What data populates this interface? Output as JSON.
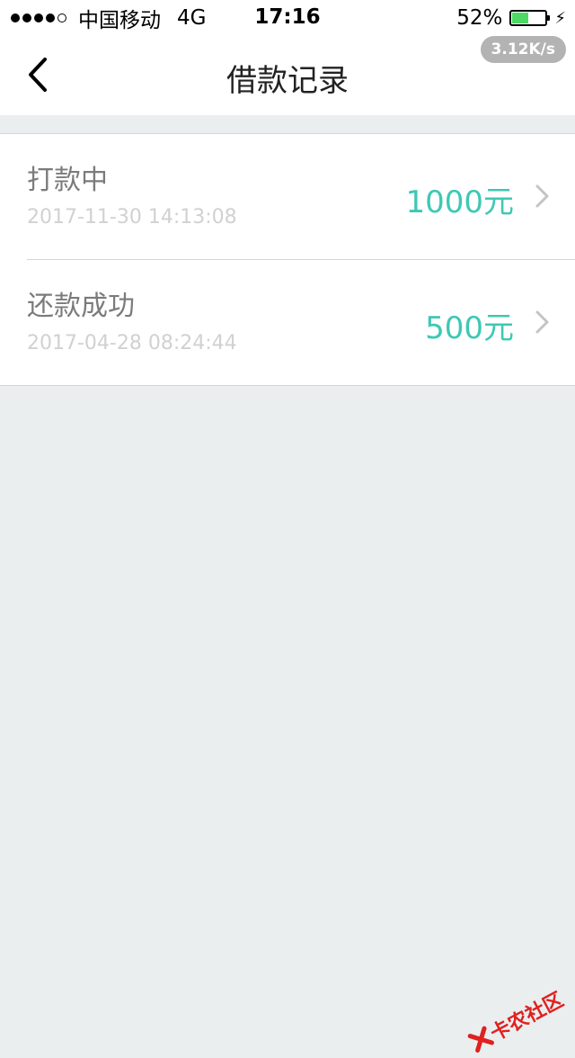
{
  "status_bar": {
    "carrier": "中国移动",
    "network": "4G",
    "time": "17:16",
    "battery_percent": "52%",
    "battery_level": 0.52,
    "signal_dots_filled": 4,
    "signal_dots_total": 5
  },
  "net_speed": "3.12K/s",
  "header": {
    "title": "借款记录"
  },
  "records": [
    {
      "status": "打款中",
      "time": "2017-11-30 14:13:08",
      "amount": "1000元"
    },
    {
      "status": "还款成功",
      "time": "2017-04-28 08:24:44",
      "amount": "500元"
    }
  ],
  "watermark": "卡农社区",
  "colors": {
    "accent": "#3ec8b4",
    "background": "#ebeeee",
    "battery": "#4cd964",
    "watermark": "#e02020"
  }
}
